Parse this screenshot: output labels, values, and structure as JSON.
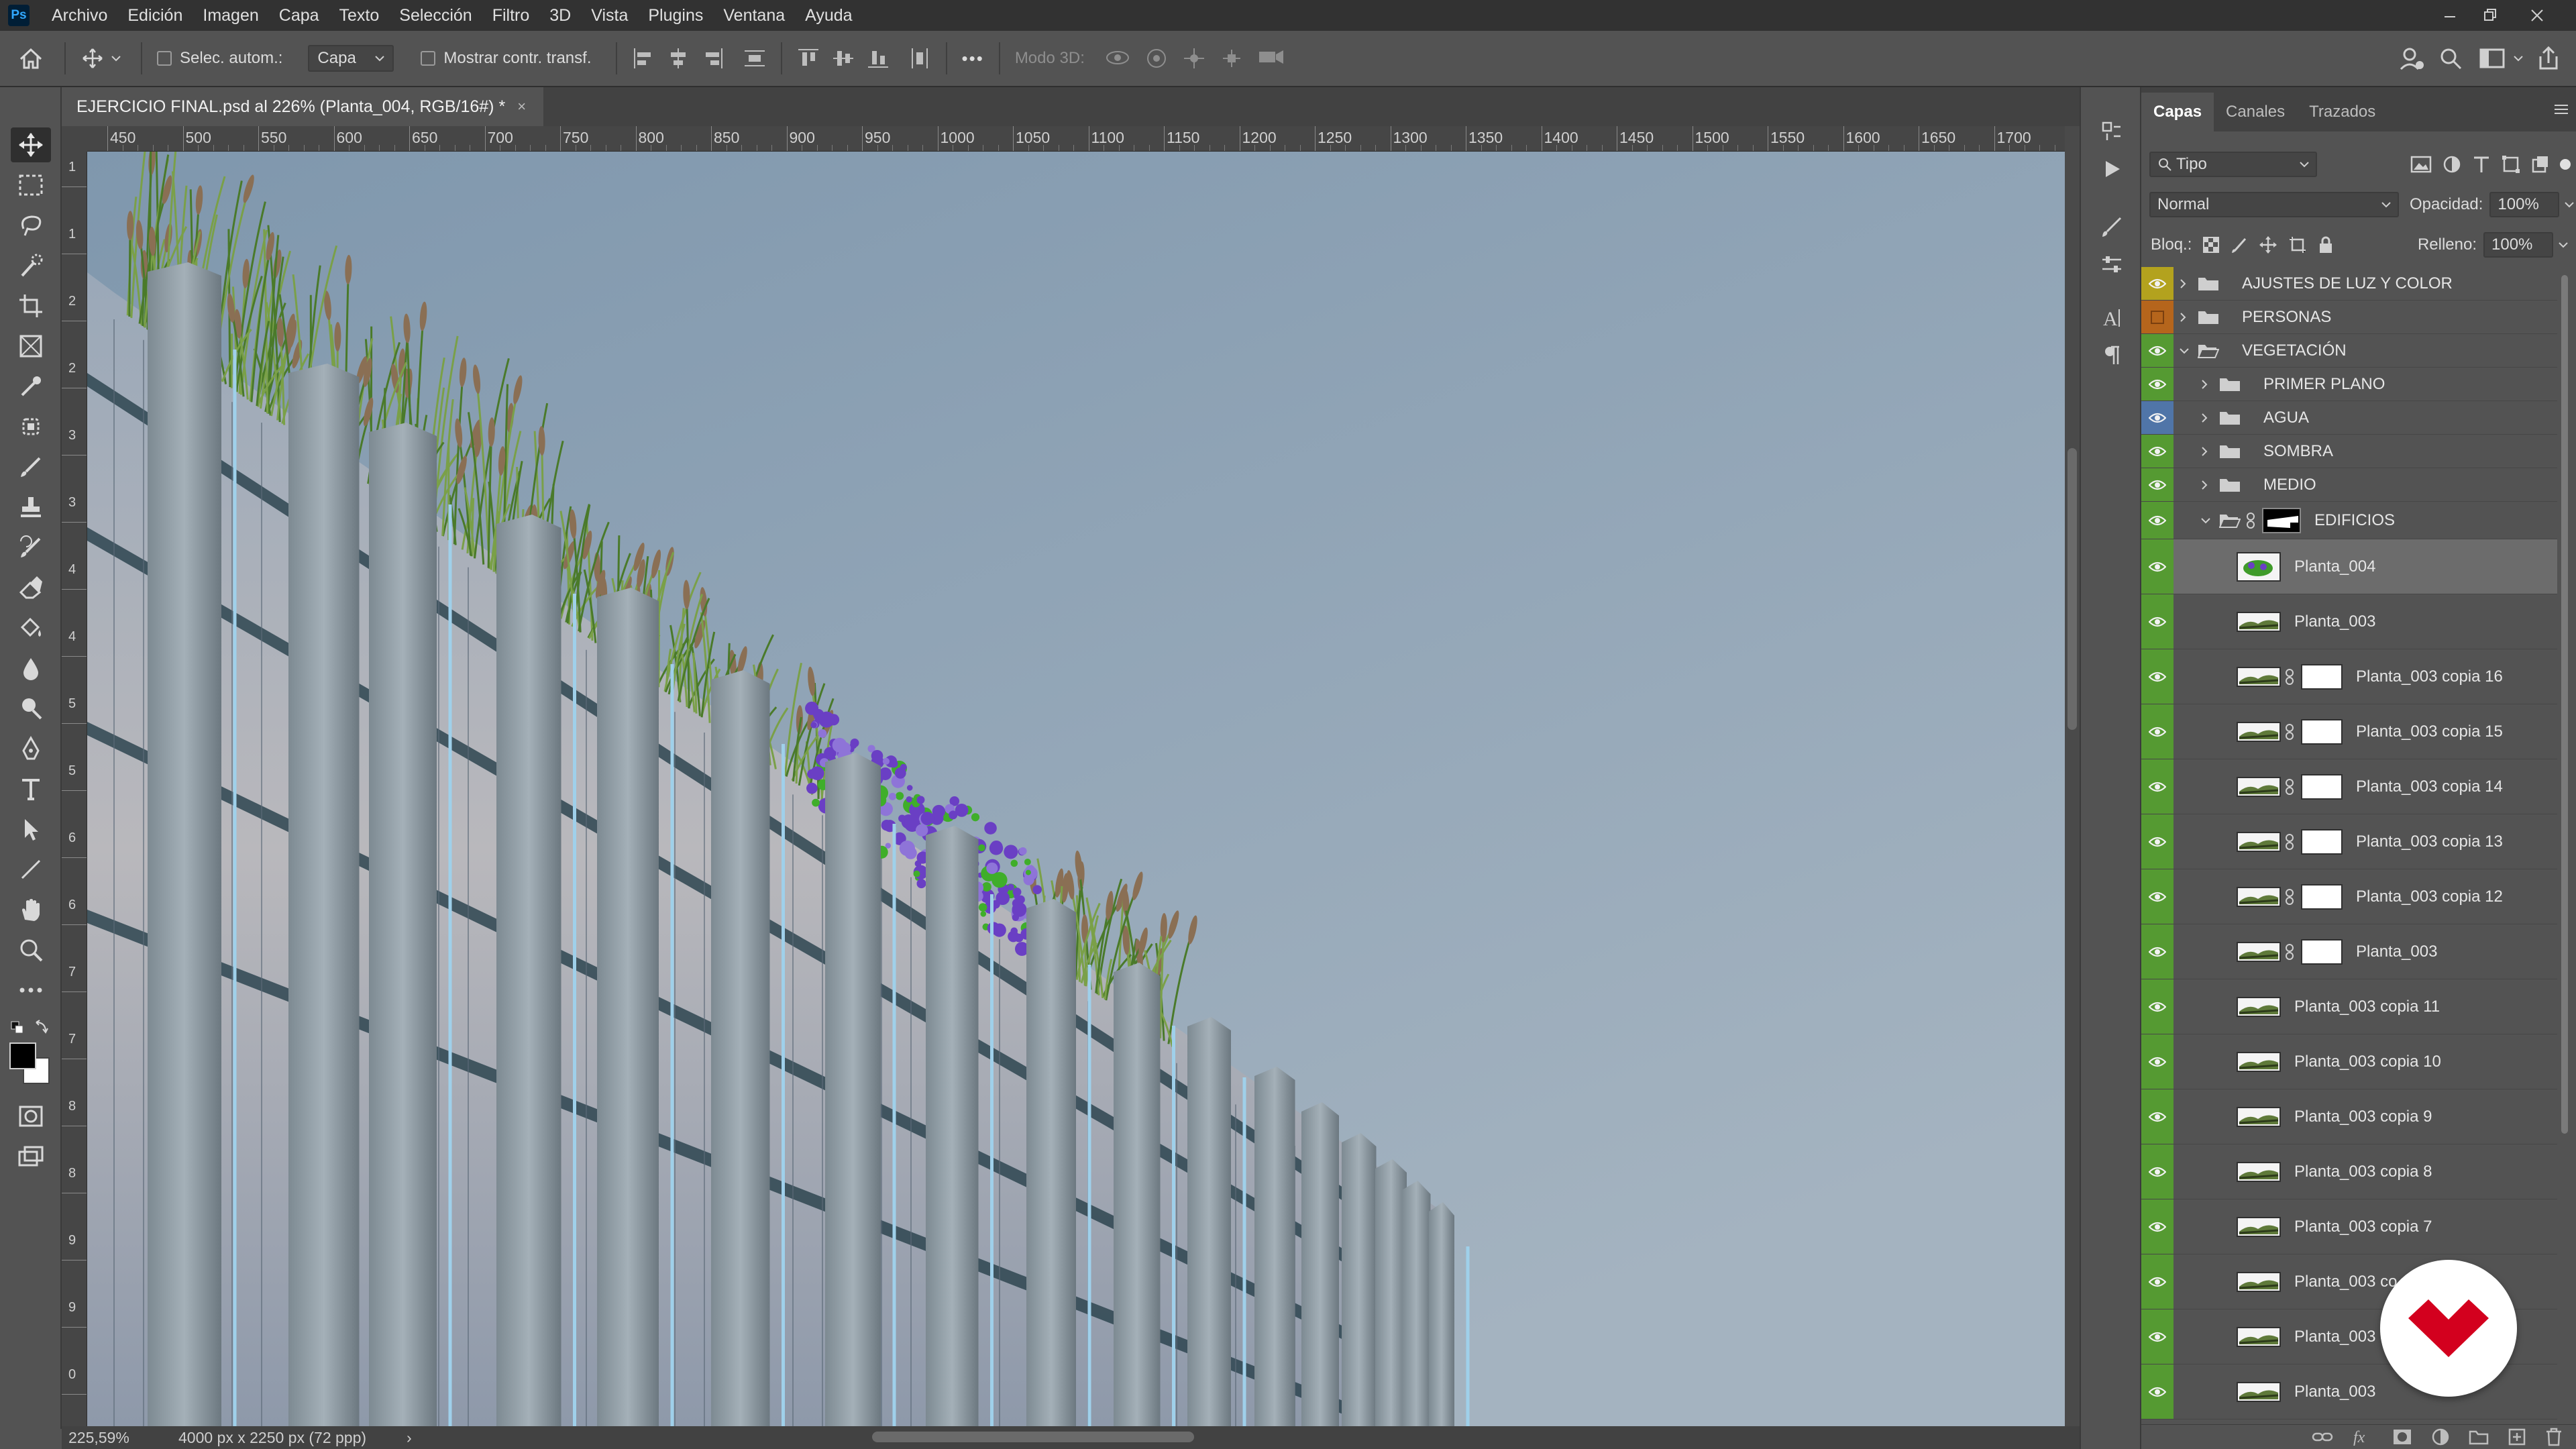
{
  "app": {
    "logo": "Ps",
    "menus": [
      "Archivo",
      "Edición",
      "Imagen",
      "Capa",
      "Texto",
      "Selección",
      "Filtro",
      "3D",
      "Vista",
      "Plugins",
      "Ventana",
      "Ayuda"
    ]
  },
  "options": {
    "auto_select_label": "Selec. autom.:",
    "auto_select_target": "Capa",
    "show_transform_label": "Mostrar contr. transf.",
    "mode_3d_label": "Modo 3D:",
    "more_label": "•••"
  },
  "document": {
    "tab_title": "EJERCICIO FINAL.psd al 226% (Planta_004, RGB/16#) *",
    "close_symbol": "×",
    "zoom_readout": "225,59%",
    "doc_info": "4000 px x 2250 px (72 ppp)",
    "status_arrow": "›"
  },
  "rulers": {
    "h_labels": [
      "450",
      "500",
      "550",
      "600",
      "650",
      "700",
      "750",
      "800",
      "850",
      "900",
      "950",
      "1000",
      "1050",
      "1100",
      "1150",
      "1200",
      "1250",
      "1300",
      "1350",
      "1400",
      "1450",
      "1500",
      "1550",
      "1600",
      "1650",
      "1700"
    ],
    "v_labels": [
      "1",
      "1",
      "2",
      "2",
      "3",
      "3",
      "4",
      "4",
      "5",
      "5",
      "6",
      "6",
      "7",
      "7",
      "8",
      "8",
      "9",
      "9",
      "0"
    ]
  },
  "layers_panel": {
    "tabs": [
      "Capas",
      "Canales",
      "Trazados"
    ],
    "filter_kind": "Tipo",
    "blend_mode": "Normal",
    "opacity_label": "Opacidad:",
    "opacity_value": "100%",
    "lock_label": "Bloq.:",
    "fill_label": "Relleno:",
    "fill_value": "100%",
    "layers": [
      {
        "name": "AJUSTES DE LUZ Y COLOR",
        "kind": "group",
        "indent": 0,
        "eye": "yellow",
        "open": false
      },
      {
        "name": "PERSONAS",
        "kind": "group",
        "indent": 0,
        "eye": "orange",
        "open": false
      },
      {
        "name": "VEGETACIÓN",
        "kind": "group",
        "indent": 0,
        "eye": "green",
        "open": true
      },
      {
        "name": "PRIMER PLANO",
        "kind": "group",
        "indent": 1,
        "eye": "green",
        "open": false
      },
      {
        "name": "AGUA",
        "kind": "group",
        "indent": 1,
        "eye": "blue",
        "open": false
      },
      {
        "name": "SOMBRA",
        "kind": "group",
        "indent": 1,
        "eye": "green",
        "open": false
      },
      {
        "name": "MEDIO",
        "kind": "group",
        "indent": 1,
        "eye": "green",
        "open": false
      },
      {
        "name": "EDIFICIOS",
        "kind": "masked-group",
        "indent": 1,
        "eye": "green",
        "open": true
      },
      {
        "name": "Planta_004",
        "kind": "image",
        "indent": 2,
        "eye": "green",
        "selected": true
      },
      {
        "name": "Planta_003",
        "kind": "grass",
        "indent": 2,
        "eye": "green"
      },
      {
        "name": "Planta_003 copia 16",
        "kind": "masked",
        "indent": 2,
        "eye": "green"
      },
      {
        "name": "Planta_003 copia 15",
        "kind": "masked",
        "indent": 2,
        "eye": "green"
      },
      {
        "name": "Planta_003 copia 14",
        "kind": "masked",
        "indent": 2,
        "eye": "green"
      },
      {
        "name": "Planta_003 copia 13",
        "kind": "masked",
        "indent": 2,
        "eye": "green"
      },
      {
        "name": "Planta_003 copia 12",
        "kind": "masked",
        "indent": 2,
        "eye": "green"
      },
      {
        "name": "Planta_003",
        "kind": "masked",
        "indent": 2,
        "eye": "green"
      },
      {
        "name": "Planta_003 copia 11",
        "kind": "grass",
        "indent": 2,
        "eye": "green"
      },
      {
        "name": "Planta_003 copia 10",
        "kind": "grass",
        "indent": 2,
        "eye": "green"
      },
      {
        "name": "Planta_003 copia 9",
        "kind": "grass",
        "indent": 2,
        "eye": "green"
      },
      {
        "name": "Planta_003 copia 8",
        "kind": "grass",
        "indent": 2,
        "eye": "green"
      },
      {
        "name": "Planta_003 copia 7",
        "kind": "grass",
        "indent": 2,
        "eye": "green"
      },
      {
        "name": "Planta_003 co",
        "kind": "grass",
        "indent": 2,
        "eye": "green"
      },
      {
        "name": "Planta_003 c",
        "kind": "grass",
        "indent": 2,
        "eye": "green"
      },
      {
        "name": "Planta_003",
        "kind": "grass",
        "indent": 2,
        "eye": "green"
      }
    ]
  },
  "colors": {
    "sky_top": "#7f97ad",
    "sky_bottom": "#a4b3c0",
    "eye_green": "#559a32",
    "brand_red": "#d3001e"
  }
}
